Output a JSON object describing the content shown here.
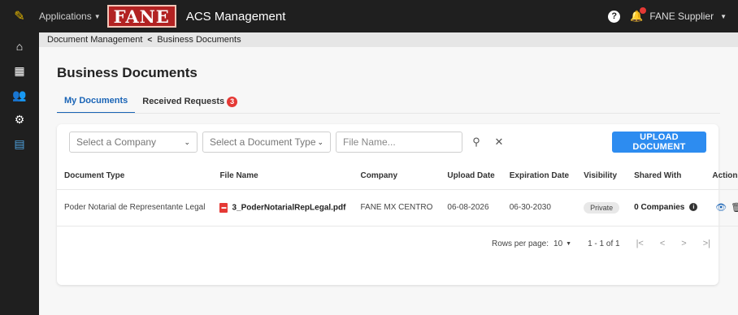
{
  "topbar": {
    "apps_label": "Applications",
    "logo_text": "FANE",
    "app_title": "ACS Management",
    "help_icon": "?",
    "user_label": "FANE Supplier"
  },
  "sidebar": {
    "items": [
      {
        "name": "home-icon",
        "glyph": "⌂"
      },
      {
        "name": "building-icon",
        "glyph": "▦"
      },
      {
        "name": "users-icon",
        "glyph": "👥"
      },
      {
        "name": "gear-icon",
        "glyph": "⚙"
      },
      {
        "name": "folder-icon",
        "glyph": "▤"
      }
    ]
  },
  "breadcrumb": {
    "parent": "Document Management",
    "separator": "<",
    "current": "Business Documents"
  },
  "page": {
    "title": "Business Documents",
    "tabs": [
      {
        "label": "My Documents",
        "active": true
      },
      {
        "label": "Received Requests",
        "badge": "3"
      }
    ]
  },
  "filters": {
    "company_placeholder": "Select a Company",
    "doc_type_placeholder": "Select a Document Type",
    "file_name_placeholder": "File Name...",
    "upload_label": "UPLOAD DOCUMENT"
  },
  "table": {
    "columns": [
      "Document Type",
      "File Name",
      "Company",
      "Upload Date",
      "Expiration Date",
      "Visibility",
      "Shared With",
      "Actions"
    ],
    "rows": [
      {
        "document_type": "Poder Notarial de Representante Legal",
        "file_name": "3_PoderNotarialRepLegal.pdf",
        "company": "FANE MX CENTRO",
        "upload_date": "06-08-2026",
        "expiration_date": "06-30-2030",
        "visibility": "Private",
        "shared_with": "0 Companies"
      }
    ]
  },
  "pagination": {
    "rows_per_page_label": "Rows per page:",
    "rows_per_page_value": "10",
    "range": "1 - 1 of 1"
  },
  "colors": {
    "topbar": "#1f1f1f",
    "accent": "#2d8cf0",
    "tab_active": "#1a64b6",
    "badge": "#e53935",
    "logo_bg": "#b22222"
  }
}
